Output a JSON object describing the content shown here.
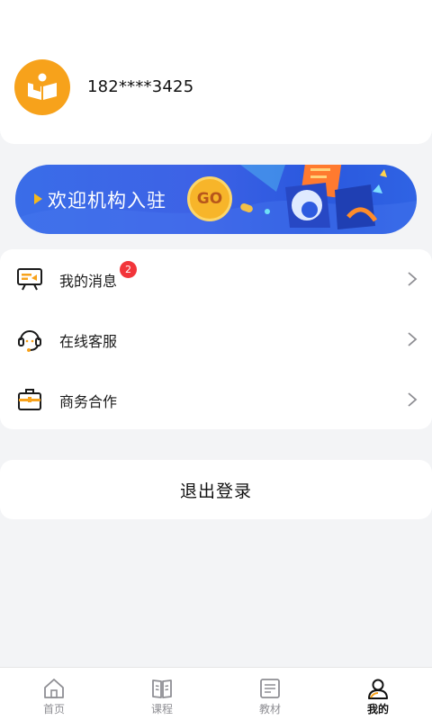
{
  "profile": {
    "phone": "182****3425",
    "avatar_icon": "book-reader-icon"
  },
  "banner": {
    "text": "欢迎机构入驻",
    "go_label": "GO"
  },
  "menu": {
    "items": [
      {
        "label": "我的消息",
        "icon": "message-board-icon",
        "badge": "2"
      },
      {
        "label": "在线客服",
        "icon": "headset-icon"
      },
      {
        "label": "商务合作",
        "icon": "briefcase-icon"
      }
    ]
  },
  "logout": {
    "label": "退出登录"
  },
  "tabbar": {
    "tabs": [
      {
        "label": "首页",
        "icon": "home-icon"
      },
      {
        "label": "课程",
        "icon": "open-book-icon"
      },
      {
        "label": "教材",
        "icon": "textbook-icon"
      },
      {
        "label": "我的",
        "icon": "user-icon",
        "active": true
      }
    ]
  },
  "colors": {
    "accent_orange": "#f7a21b",
    "banner_blue": "#3d62e6",
    "badge_red": "#f2353a",
    "background": "#f3f4f6"
  }
}
